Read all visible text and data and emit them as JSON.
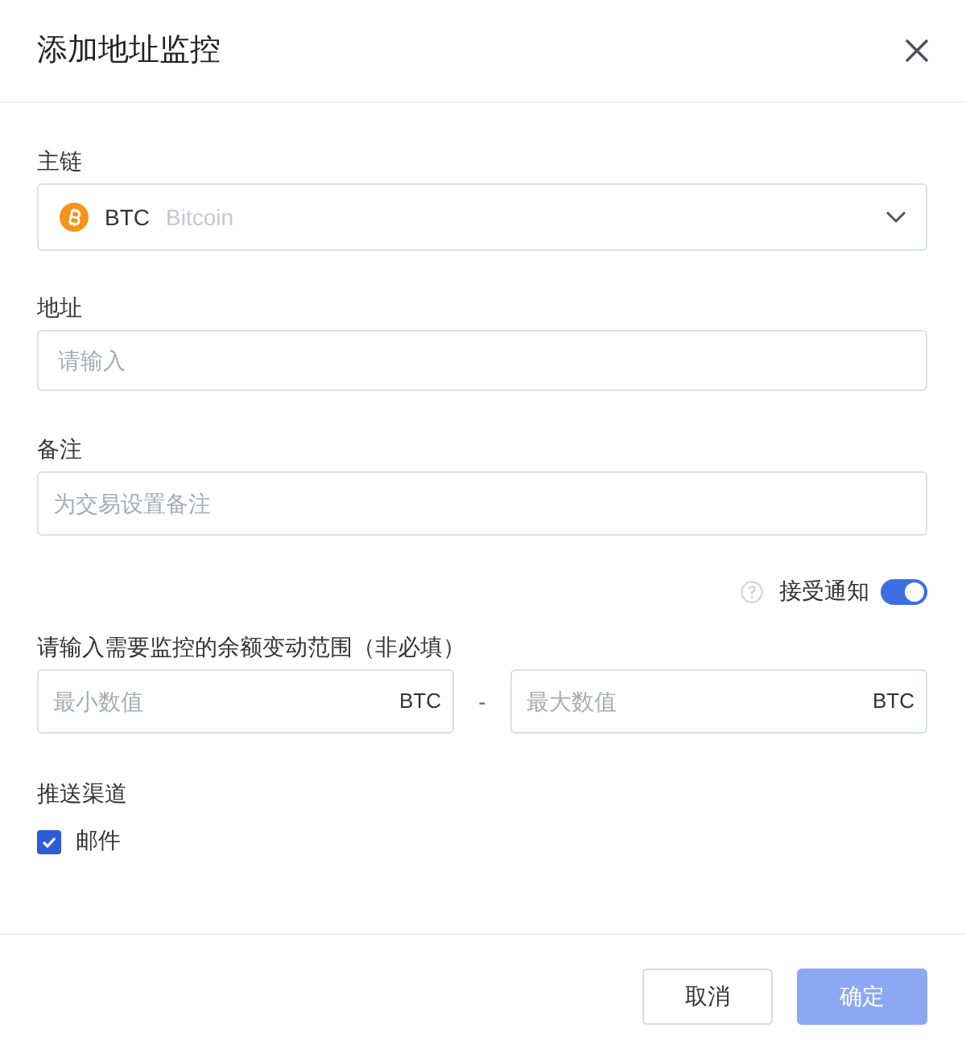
{
  "dialog": {
    "title": "添加地址监控"
  },
  "chain": {
    "label": "主链",
    "symbol": "BTC",
    "name": "Bitcoin"
  },
  "address": {
    "label": "地址",
    "placeholder": "请输入"
  },
  "note": {
    "label": "备注",
    "placeholder": "为交易设置备注"
  },
  "notify": {
    "label": "接受通知",
    "on": true
  },
  "range": {
    "label": "请输入需要监控的余额变动范围（非必填）",
    "min": {
      "placeholder": "最小数值",
      "unit": "BTC"
    },
    "separator": "-",
    "max": {
      "placeholder": "最大数值",
      "unit": "BTC"
    }
  },
  "channels": {
    "label": "推送渠道",
    "options": [
      {
        "label": "邮件",
        "checked": true
      }
    ]
  },
  "buttons": [
    {
      "label": "取消",
      "kind": "secondary",
      "disabled": false
    },
    {
      "label": "确定",
      "kind": "primary",
      "disabled": true
    }
  ]
}
